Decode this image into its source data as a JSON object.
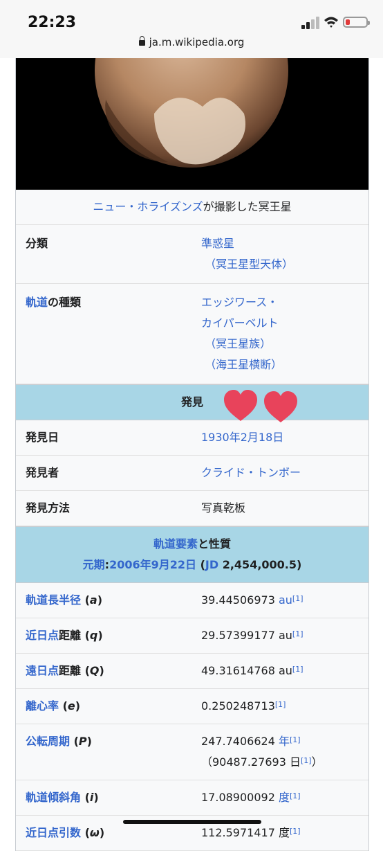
{
  "status_bar": {
    "time": "22:23",
    "url": "ja.m.wikipedia.org"
  },
  "infobox": {
    "caption_link": "ニュー・ホライズンズ",
    "caption_text": "が撮影した冥王星",
    "rows": [
      {
        "key": "分類",
        "value_link": "準惑星",
        "value_sub": "（冥王星型天体）"
      },
      {
        "key_link": "軌道",
        "key_text": "の種類",
        "value_line1": "エッジワース・",
        "value_line2": "カイパーベルト",
        "value_sub1": "（冥王星族）",
        "value_sub2": "（海王星横断）"
      }
    ],
    "discovery_header": "発見",
    "discovery": [
      {
        "key": "発見日",
        "value": "1930年2月18日"
      },
      {
        "key": "発見者",
        "value": "クライド・トンボー"
      },
      {
        "key": "発見方法",
        "value": "写真乾板"
      }
    ],
    "orbit_header": {
      "link": "軌道要素",
      "text": "と性質",
      "epoch_link1": "元期",
      "colon": ":",
      "epoch_link2": "2006年9月22日",
      "paren_open": " (",
      "jd_link": "JD",
      "jd_value": " 2,454,000.5)"
    },
    "orbit": [
      {
        "key_link": "軌道長半径",
        "sym": "a",
        "value": "39.44506973 ",
        "unit": "au",
        "ref": "[1]"
      },
      {
        "key_link": "近日点",
        "key_text": "距離",
        "sym": "q",
        "value": "29.57399177 au",
        "ref": "[1]"
      },
      {
        "key_link": "遠日点",
        "key_text": "距離",
        "sym": "Q",
        "value": "49.31614768 au",
        "ref": "[1]"
      },
      {
        "key_link": "離心率",
        "sym": "e",
        "value": "0.250248713",
        "ref": "[1]"
      },
      {
        "key_link": "公転周期",
        "sym": "P",
        "value": "247.7406624 ",
        "unit": "年",
        "ref": "[1]",
        "sub_value": "（90487.27693 日",
        "sub_ref": "[1]",
        "sub_close": "）"
      },
      {
        "key_link": "軌道傾斜角",
        "sym": "i",
        "value": "17.08900092 ",
        "unit": "度",
        "ref": "[1]"
      },
      {
        "key_link": "近日点引数",
        "sym": "ω",
        "value": "112.5971417 度",
        "ref": "[1]"
      }
    ]
  },
  "colors": {
    "link": "#3366cc",
    "section_bg": "#a8d6e6",
    "heart": "#e8435b"
  }
}
